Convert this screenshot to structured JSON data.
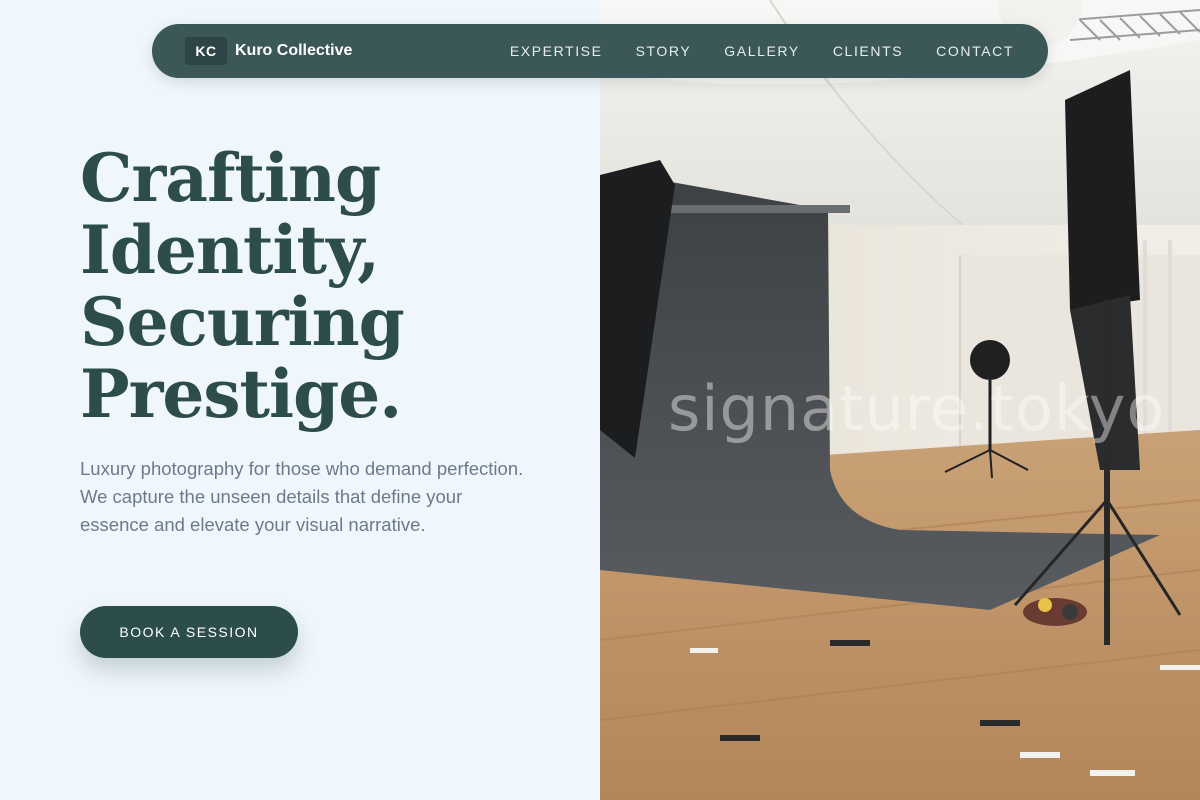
{
  "nav": {
    "logo_initials": "KC",
    "brand_name": "Kuro Collective",
    "links": [
      "EXPERTISE",
      "STORY",
      "GALLERY",
      "CLIENTS",
      "CONTACT"
    ]
  },
  "hero": {
    "headline_lines": [
      "Crafting",
      "Identity,",
      "Securing",
      "Prestige."
    ],
    "subtext": "Luxury photography for those who demand perfection. We capture the unseen details that define your essence and elevate your visual narrative.",
    "cta_label": "BOOK A SESSION"
  },
  "image": {
    "watermark": "signature.tokyo"
  },
  "colors": {
    "page_bg": "#eff6fd",
    "nav_bg": "#3b5757",
    "accent": "#2d4d4d",
    "body_text": "#6d7b87"
  }
}
